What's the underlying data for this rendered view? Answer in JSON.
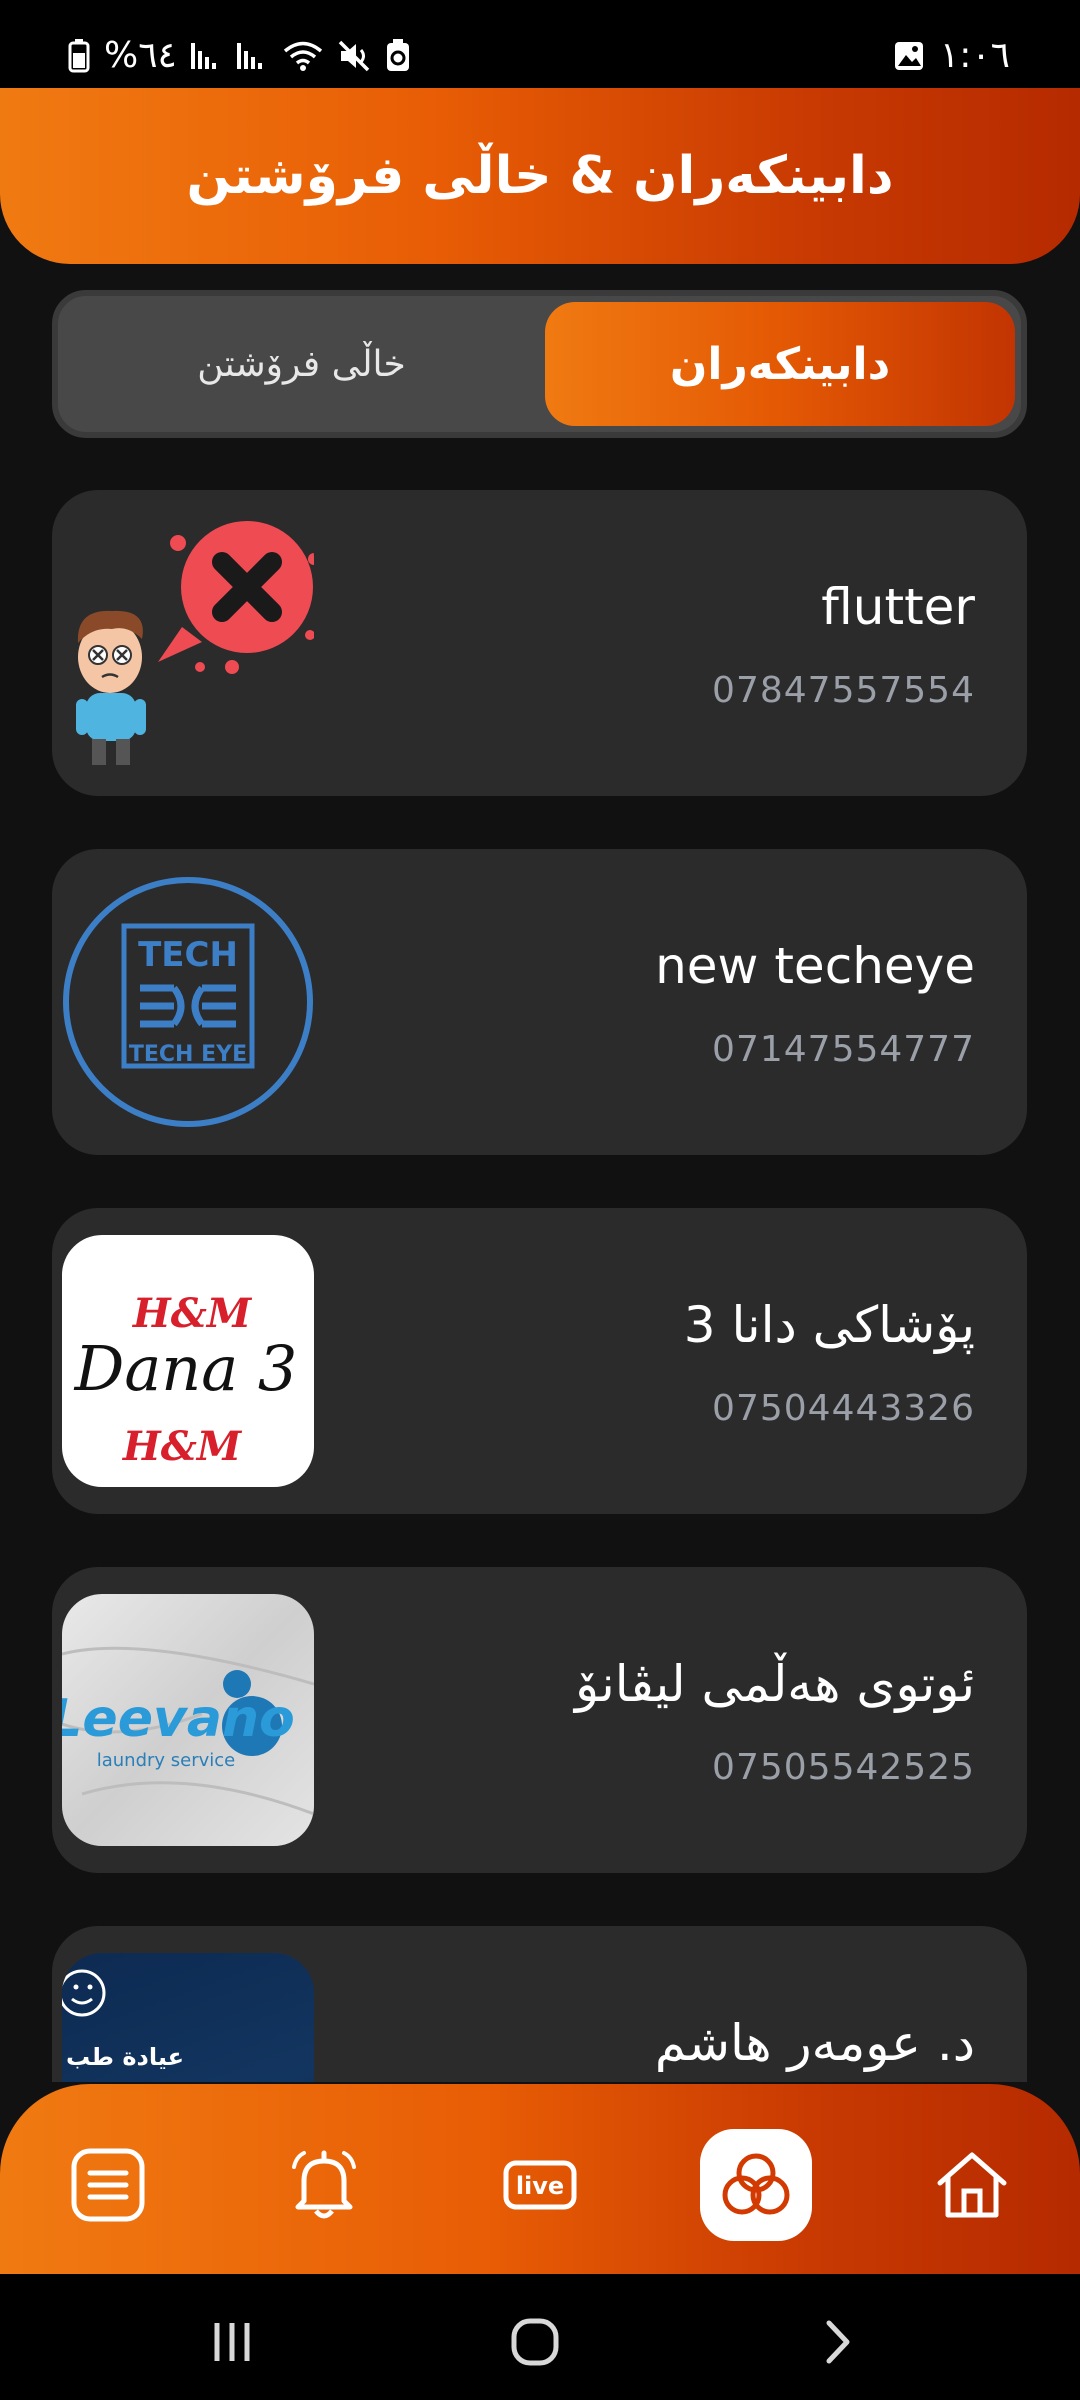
{
  "status_bar": {
    "battery": "%٦٤",
    "time": "١:٠٦"
  },
  "header": {
    "title": "دابینکەران & خاڵی فرۆشتن"
  },
  "tabs": {
    "active": "دابینکەران",
    "inactive": "خاڵی فرۆشتن"
  },
  "suppliers": [
    {
      "name": "flutter",
      "phone": "07847557554",
      "thumb": "no-image-placeholder"
    },
    {
      "name": "new techeye",
      "phone": "07147554777",
      "thumb": "tech-eye-logo"
    },
    {
      "name": "پۆشاکی دانا 3",
      "phone": "07504443326",
      "thumb": "dana-3-hm-logo"
    },
    {
      "name": "ئوتوی هەڵمی لیڤانۆ",
      "phone": "07505542525",
      "thumb": "leevano-logo"
    },
    {
      "name": "د. عومەر هاشم",
      "phone": "",
      "thumb": "clinic-photo"
    }
  ],
  "logos": {
    "tech_top": "TECH",
    "tech_bottom": "TECH EYE",
    "hm": "H&M",
    "dana": "Dana 3",
    "leevano": "Leevano",
    "leevano_sub": "laundry service",
    "clinic": "عيادة طب"
  },
  "bottom_nav": {
    "items": [
      "menu-icon",
      "bell-icon",
      "live-icon",
      "stores-icon",
      "home-icon"
    ],
    "live_label": "live",
    "active": "stores-icon"
  },
  "colors": {
    "accent": "#e85d05",
    "accent_dark": "#b52a00",
    "card": "#2b2b2c",
    "background": "#111111"
  }
}
